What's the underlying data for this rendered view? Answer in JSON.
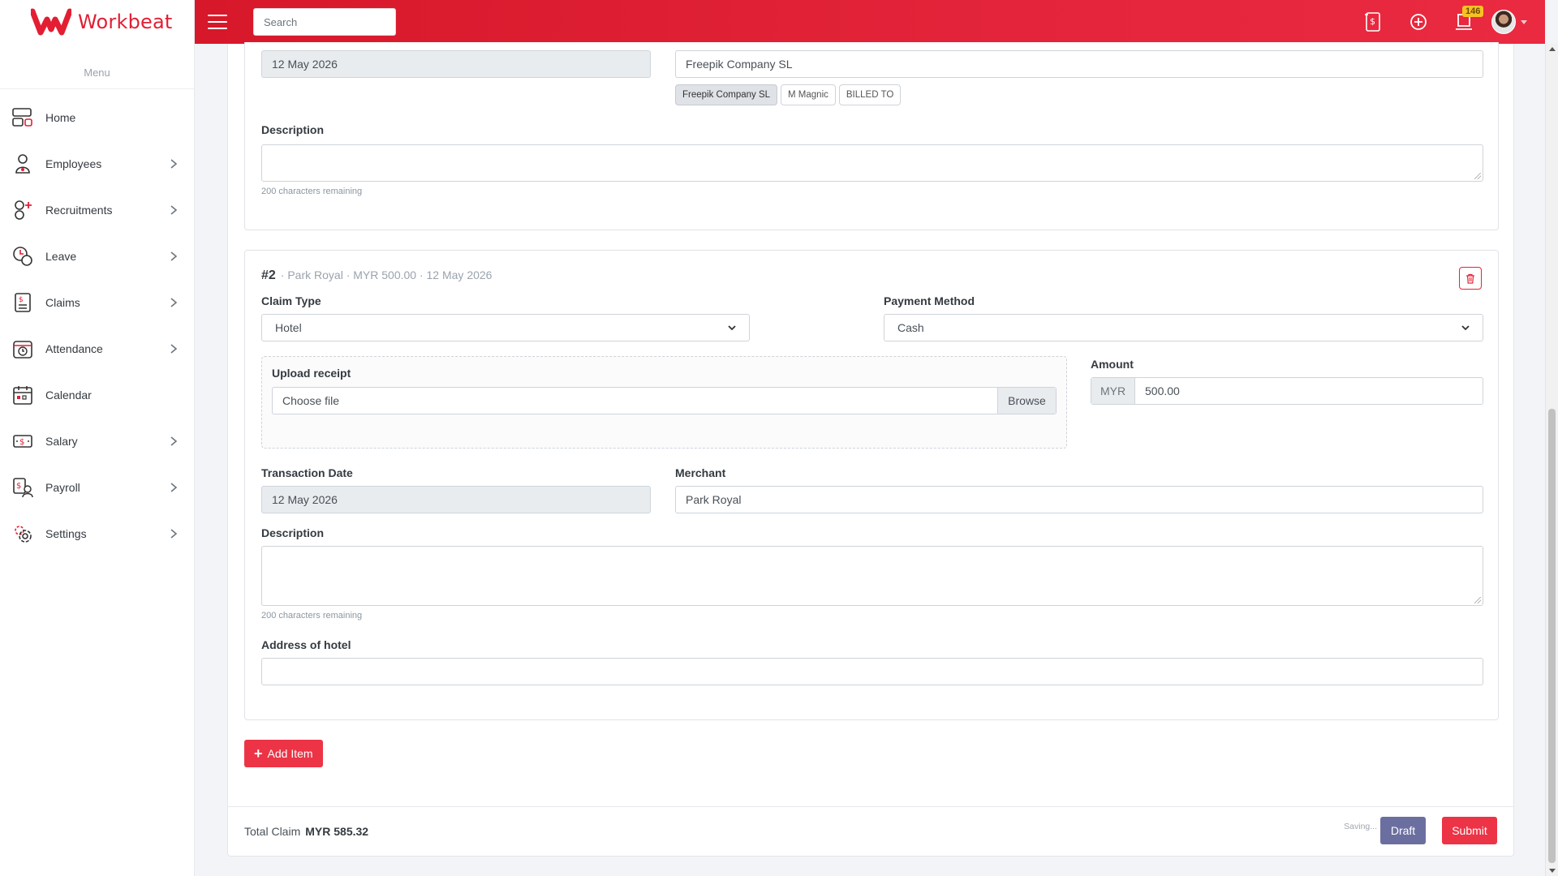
{
  "app": {
    "name": "Workbeat"
  },
  "sidebar": {
    "menu_title": "Menu",
    "items": [
      {
        "label": "Home",
        "icon": "home-icon"
      },
      {
        "label": "Employees",
        "icon": "employee-icon"
      },
      {
        "label": "Recruitments",
        "icon": "recruitment-icon"
      },
      {
        "label": "Leave",
        "icon": "leave-icon"
      },
      {
        "label": "Claims",
        "icon": "claims-icon"
      },
      {
        "label": "Attendance",
        "icon": "attendance-icon"
      },
      {
        "label": "Calendar",
        "icon": "calendar-icon"
      },
      {
        "label": "Salary",
        "icon": "salary-icon"
      },
      {
        "label": "Payroll",
        "icon": "payroll-icon"
      },
      {
        "label": "Settings",
        "icon": "settings-icon"
      }
    ]
  },
  "topbar": {
    "search_placeholder": "Search",
    "notification_count": "146"
  },
  "item1": {
    "transaction_date": "12 May 2026",
    "merchant": "Freepik Company SL",
    "merchant_suggestions": [
      "Freepik Company SL",
      "M Magnic",
      "BILLED TO"
    ],
    "description_label": "Description",
    "description_hint": "200 characters remaining"
  },
  "item2": {
    "number": "#2",
    "meta": "· Park Royal · MYR 500.00 · 12 May 2026",
    "claim_type_label": "Claim Type",
    "claim_type_value": "Hotel",
    "payment_method_label": "Payment Method",
    "payment_method_value": "Cash",
    "upload_label": "Upload receipt",
    "upload_placeholder": "Choose file",
    "browse_label": "Browse",
    "amount_label": "Amount",
    "amount_currency": "MYR",
    "amount_value": "500.00",
    "transaction_date_label": "Transaction Date",
    "transaction_date": "12 May 2026",
    "merchant_label": "Merchant",
    "merchant": "Park Royal",
    "description_label": "Description",
    "description_hint": "200 characters remaining",
    "address_label": "Address of hotel"
  },
  "actions": {
    "add_item": "Add Item",
    "total_label": "Total Claim",
    "total_value": "MYR 585.32",
    "saving": "Saving...",
    "draft": "Draft",
    "submit": "Submit"
  },
  "colors": {
    "brand": "#e31e33",
    "submit": "#ec3446",
    "draft": "#6b6fa0"
  }
}
